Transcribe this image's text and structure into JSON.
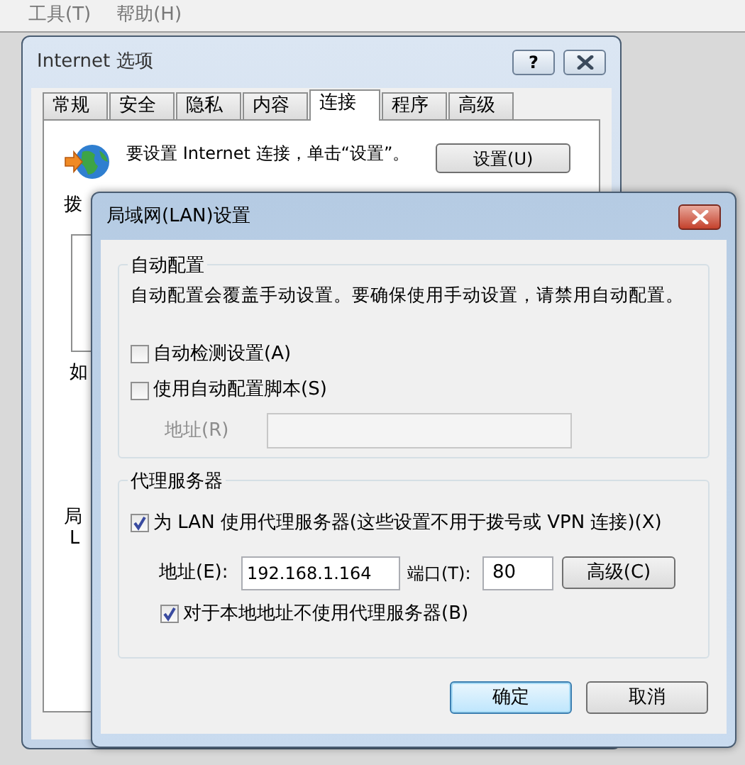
{
  "menu_bar": {
    "items": [
      "工具(T)",
      "帮助(H)"
    ]
  },
  "internet_options": {
    "title": "Internet 选项",
    "help_button": "?",
    "tabs": [
      {
        "label": "常规",
        "selected": false
      },
      {
        "label": "安全",
        "selected": false
      },
      {
        "label": "隐私",
        "selected": false
      },
      {
        "label": "内容",
        "selected": false
      },
      {
        "label": "连接",
        "selected": true
      },
      {
        "label": "程序",
        "selected": false
      },
      {
        "label": "高级",
        "selected": false
      }
    ],
    "setup_text": "要设置 Internet 连接，单击“设置”。",
    "setup_button": "设置(U)",
    "cut_labels": [
      "拨",
      "如",
      "局",
      "L"
    ]
  },
  "lan_dialog": {
    "title": "局域网(LAN)设置",
    "auto_config": {
      "legend": "自动配置",
      "description": "自动配置会覆盖手动设置。要确保使用手动设置，请禁用自动配置。",
      "checkboxes": [
        {
          "label": "自动检测设置(A)",
          "checked": false
        },
        {
          "label": "使用自动配置脚本(S)",
          "checked": false
        }
      ],
      "script_address": {
        "label": "地址(R)",
        "disabled": true
      }
    },
    "proxy": {
      "legend": "代理服务器",
      "use_proxy": {
        "label": "为 LAN 使用代理服务器(这些设置不用于拨号或 VPN 连接)(X)",
        "checked": true
      },
      "address_label": "地址(E):",
      "address_value": "192.168.1.164",
      "port_label": "端口(T):",
      "port_value": "80",
      "advanced_button": "高级(C)",
      "bypass_local": {
        "label": "对于本地地址不使用代理服务器(B)",
        "checked": true
      }
    },
    "buttons": [
      {
        "label": "确定",
        "default": true
      },
      {
        "label": "取消",
        "default": false
      }
    ]
  }
}
